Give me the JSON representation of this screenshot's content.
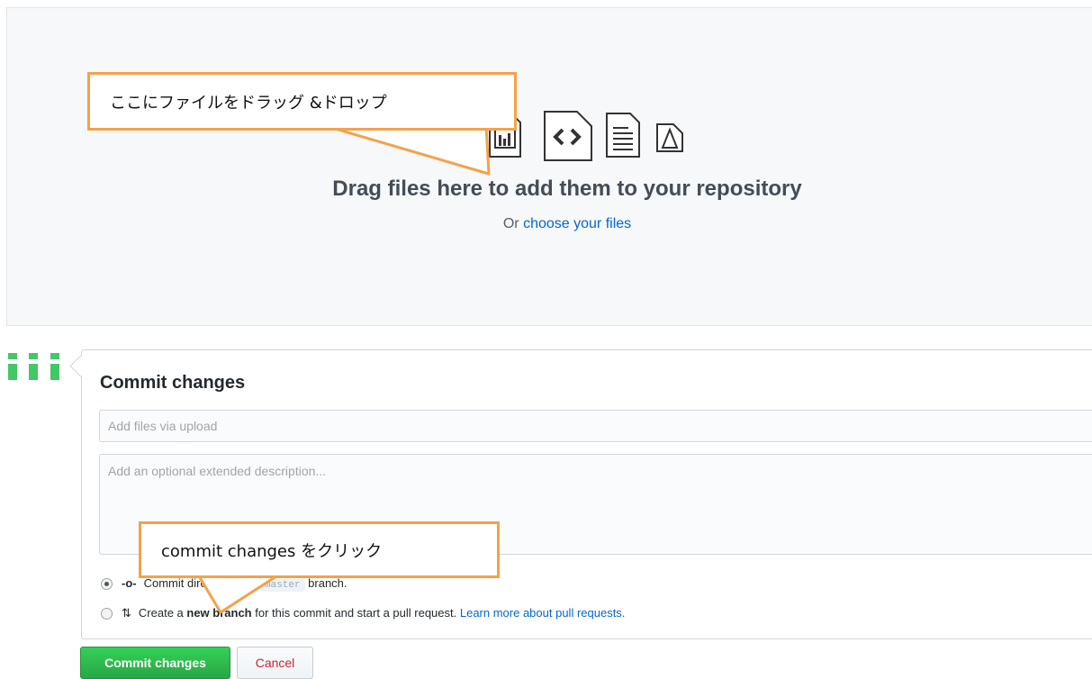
{
  "dropzone": {
    "title": "Drag files here to add them to your repository",
    "sub_prefix": "Or ",
    "sub_link": "choose your files",
    "icons": [
      "image-file-icon",
      "chart-file-icon",
      "code-file-icon",
      "text-file-icon",
      "pdf-file-icon"
    ]
  },
  "commit": {
    "title": "Commit changes",
    "summary_placeholder": "Add files via upload",
    "description_placeholder": "Add an optional extended description...",
    "option1": {
      "prefix": "Commit directly to the ",
      "branch": "master",
      "suffix": " branch."
    },
    "option2": {
      "prefix": "Create a ",
      "bold": "new branch",
      "middle": " for this commit and start a pull request. ",
      "link": "Learn more about pull requests."
    },
    "commit_button": "Commit changes",
    "cancel_button": "Cancel"
  },
  "annotations": {
    "drag_drop": "ここにファイルをドラッグ &ドロップ",
    "click_commit": "commit changes をクリック"
  },
  "colors": {
    "accent_orange": "#f4a14b",
    "link_blue": "#0366d6",
    "commit_green": "#28a745",
    "cancel_red": "#cb2431",
    "avatar_green": "#44c767"
  }
}
